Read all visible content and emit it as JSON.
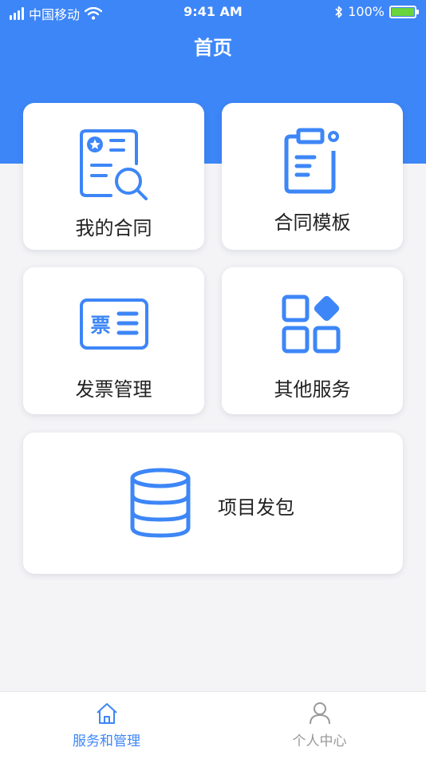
{
  "status_bar": {
    "carrier": "中国移动",
    "time": "9:41 AM",
    "battery": "100%",
    "battery_level": 1.0
  },
  "nav": {
    "title": "首页"
  },
  "cards": [
    {
      "label": "我的合同",
      "icon": "contract-search-icon"
    },
    {
      "label": "合同模板",
      "icon": "clipboard-icon"
    },
    {
      "label": "发票管理",
      "icon": "ticket-icon"
    },
    {
      "label": "其他服务",
      "icon": "grid-apps-icon"
    },
    {
      "label": "项目发包",
      "icon": "database-icon"
    }
  ],
  "tabs": [
    {
      "label": "服务和管理",
      "icon": "home-icon",
      "active": true
    },
    {
      "label": "个人中心",
      "icon": "user-icon",
      "active": false
    }
  ],
  "colors": {
    "brand": "#3d86f7",
    "icon": "#3d86f7",
    "tab_active": "#3d86f7",
    "tab_inactive": "#999999",
    "battery": "#69d43b"
  }
}
